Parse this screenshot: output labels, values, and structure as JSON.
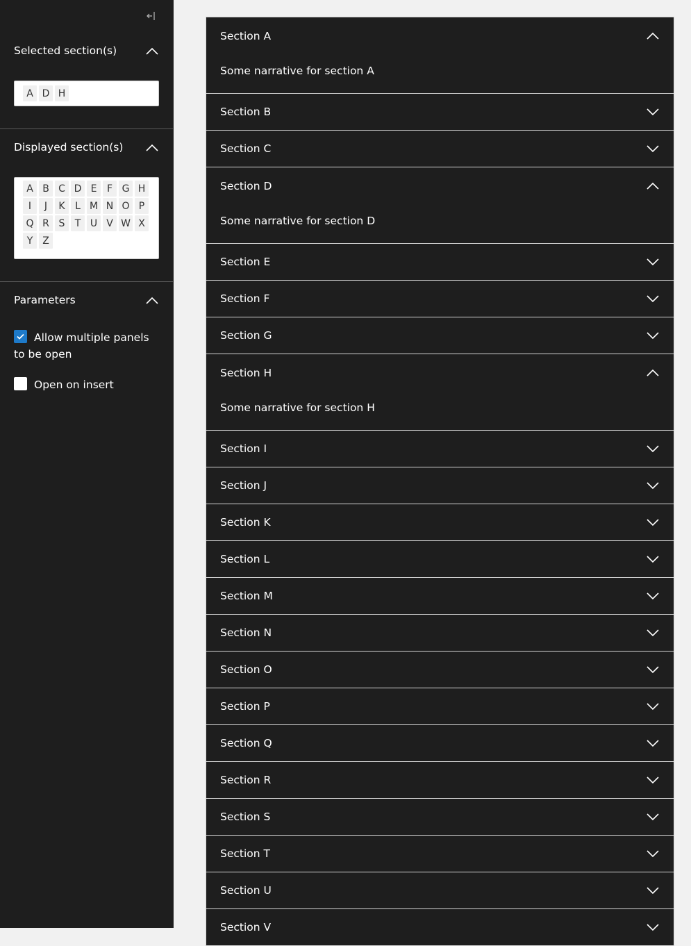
{
  "sidebar": {
    "collapse_icon": "collapse-left-icon",
    "selected": {
      "title": "Selected section(s)",
      "tags": [
        "A",
        "D",
        "H"
      ]
    },
    "displayed": {
      "title": "Displayed section(s)",
      "tags": [
        "A",
        "B",
        "C",
        "D",
        "E",
        "F",
        "G",
        "H",
        "I",
        "J",
        "K",
        "L",
        "M",
        "N",
        "O",
        "P",
        "Q",
        "R",
        "S",
        "T",
        "U",
        "V",
        "W",
        "X",
        "Y",
        "Z"
      ]
    },
    "parameters": {
      "title": "Parameters",
      "allow_multiple": {
        "label": "Allow multiple panels to be open",
        "checked": true
      },
      "open_on_insert": {
        "label": "Open on insert",
        "checked": false
      }
    }
  },
  "accordion": {
    "panels": [
      {
        "title": "Section A",
        "open": true,
        "body": "Some narrative for section A"
      },
      {
        "title": "Section B",
        "open": false
      },
      {
        "title": "Section C",
        "open": false
      },
      {
        "title": "Section D",
        "open": true,
        "body": "Some narrative for section D"
      },
      {
        "title": "Section E",
        "open": false
      },
      {
        "title": "Section F",
        "open": false
      },
      {
        "title": "Section G",
        "open": false
      },
      {
        "title": "Section H",
        "open": true,
        "body": "Some narrative for section H"
      },
      {
        "title": "Section I",
        "open": false
      },
      {
        "title": "Section J",
        "open": false
      },
      {
        "title": "Section K",
        "open": false
      },
      {
        "title": "Section L",
        "open": false
      },
      {
        "title": "Section M",
        "open": false
      },
      {
        "title": "Section N",
        "open": false
      },
      {
        "title": "Section O",
        "open": false
      },
      {
        "title": "Section P",
        "open": false
      },
      {
        "title": "Section Q",
        "open": false
      },
      {
        "title": "Section R",
        "open": false
      },
      {
        "title": "Section S",
        "open": false
      },
      {
        "title": "Section T",
        "open": false
      },
      {
        "title": "Section U",
        "open": false
      },
      {
        "title": "Section V",
        "open": false
      }
    ]
  },
  "colors": {
    "panel_bg": "#1e1e1e",
    "page_bg": "#f1f1f1",
    "accent": "#1e7ac9"
  }
}
